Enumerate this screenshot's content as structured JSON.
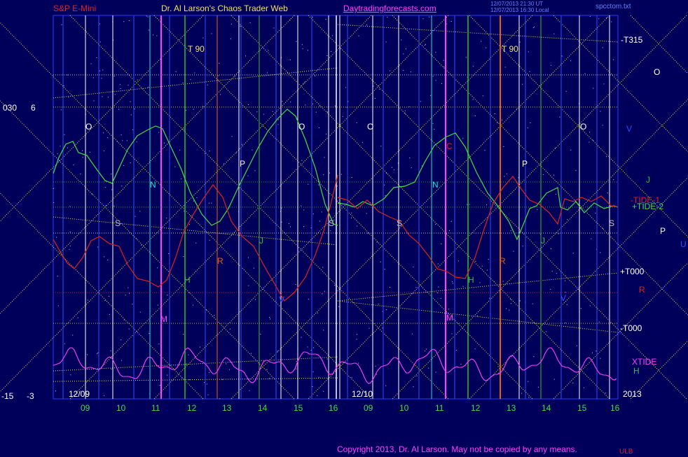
{
  "header": {
    "instrument": "S&P E-Mini",
    "author": "Dr. Al Larson's Chaos Trader Web",
    "site": "Daytradingforecasts.com",
    "timestamp1": "12/07/2013 21:30 UT",
    "timestamp2": "12/07/2013 16:30 Local",
    "file": "spcctom.txt"
  },
  "left_axis": {
    "top_a": "030",
    "top_b": "6",
    "bot_a": "-15",
    "bot_b": "-3"
  },
  "right_labels": {
    "t315": "-T315",
    "o": "O",
    "v": "V",
    "j": "J",
    "tide1": "-TIDE-1",
    "tide2": "+TIDE-2",
    "p": "P",
    "u": "U",
    "t000p": "+T000",
    "r": "R",
    "t000m": "-T000",
    "xtide": "XTIDE",
    "h": "H",
    "year": "2013"
  },
  "copyright": "Copyright 2013, Dr. Al Larson. May not be copied by any means.",
  "copyright_tail": "ULB",
  "chart_data": {
    "type": "line",
    "dates": [
      "12/09",
      "12/10"
    ],
    "x_tick_labels": [
      "09",
      "10",
      "11",
      "12",
      "13",
      "14",
      "15",
      "16",
      "09",
      "10",
      "11",
      "12",
      "13",
      "14",
      "15",
      "16"
    ],
    "x": [
      9,
      9.5,
      10,
      10.5,
      11,
      11.5,
      12,
      12.5,
      13,
      13.5,
      14,
      14.5,
      15,
      15.5,
      16
    ],
    "y_tick_labels_left": [
      "030",
      "6",
      "-15",
      "-3"
    ],
    "right_axis_labels": [
      "-T315",
      "+T000",
      "-T000"
    ],
    "colors": {
      "background": "#00005a",
      "tide2": "#44dd44",
      "tide1": "#e02020",
      "xtide": "#ff40ff",
      "grid_yellow": "#e8e050",
      "vline_blue": "#3050ff",
      "vline_white": "#ffffff",
      "cyan": "#20e0e0",
      "magenta": "#ff40ff",
      "green": "#30c030",
      "orange": "#e06020",
      "red": "#e02020"
    },
    "series": [
      {
        "name": "+TIDE-2",
        "values": []
      },
      {
        "name": "-TIDE-1",
        "values": []
      },
      {
        "name": "XTIDE",
        "values": []
      }
    ],
    "markers": [
      {
        "label": "O",
        "color": "#ffffff"
      },
      {
        "label": "S",
        "color": "#c0c0c0"
      },
      {
        "label": "N",
        "color": "#20e0e0"
      },
      {
        "label": "M",
        "color": "#ff40ff"
      },
      {
        "label": "H",
        "color": "#30c030"
      },
      {
        "label": "R",
        "color": "#e06020"
      },
      {
        "label": "P",
        "color": "#ffffff"
      },
      {
        "label": "J",
        "color": "#30c030"
      },
      {
        "label": "V",
        "color": "#3050ff"
      },
      {
        "label": "C",
        "color": "#e02020"
      },
      {
        "label": "T 90",
        "color": "#f0e070"
      }
    ]
  }
}
